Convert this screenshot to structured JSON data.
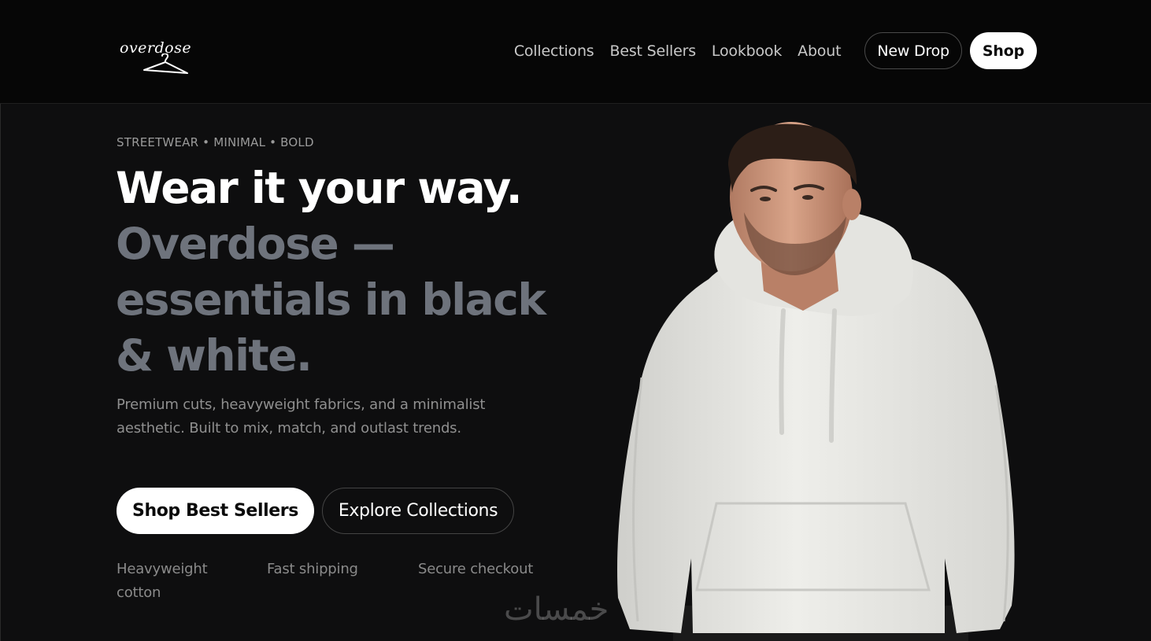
{
  "brand": {
    "logo_text": "overdose",
    "logo_icon": "hanger-icon"
  },
  "nav": {
    "links": [
      "Collections",
      "Best Sellers",
      "Lookbook",
      "About"
    ],
    "new_drop_label": "New Drop",
    "shop_label": "Shop"
  },
  "hero": {
    "eyebrow": "STREETWEAR • MINIMAL • BOLD",
    "headline_white": "Wear it your way.",
    "headline_grey": "Overdose — essentials in black & white.",
    "description": "Premium cuts, heavyweight fabrics, and a minimalist aesthetic. Built to mix, match, and outlast trends.",
    "primary_cta": "Shop Best Sellers",
    "secondary_cta": "Explore Collections",
    "features": [
      "Heavyweight cotton",
      "Fast shipping",
      "Secure checkout"
    ]
  },
  "watermark": {
    "text": "خمسات"
  },
  "colors": {
    "background": "#0e0e0f",
    "header_background": "#060606",
    "headline_grey": "#6e737c",
    "hoodie": "#e9e8e4"
  }
}
